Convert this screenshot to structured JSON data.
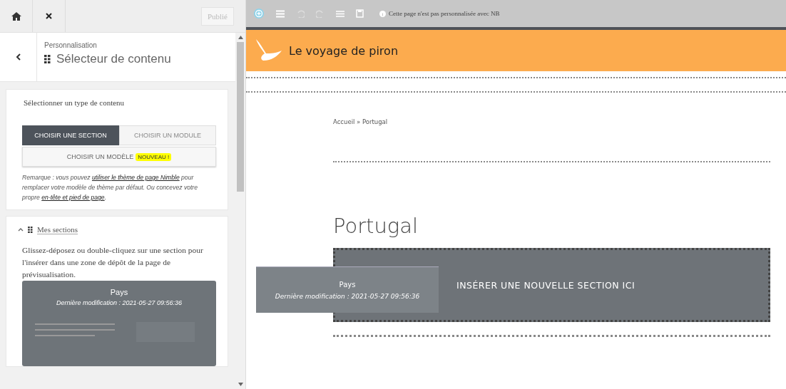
{
  "topbar": {
    "publish": "Publié"
  },
  "header": {
    "breadcrumb": "Personnalisation",
    "title": "Sélecteur de contenu"
  },
  "content_type": {
    "label": "Sélectionner un type de contenu",
    "tabs": [
      {
        "label": "CHOISIR UNE SECTION",
        "selected": true
      },
      {
        "label": "CHOISIR UN MODULE",
        "selected": false
      }
    ],
    "template_button": "CHOISIR UN MODÈLE",
    "template_badge": "NOUVEAU !",
    "note": [
      {
        "kind": "text",
        "text": "Remarque : vous pouvez "
      },
      {
        "kind": "link",
        "text": "utiliser le thème de page Nimble"
      },
      {
        "kind": "text",
        "text": " pour remplacer votre modèle de thème par défaut. Ou concevez votre propre "
      },
      {
        "kind": "link",
        "text": "en-tête et pied de page"
      },
      {
        "kind": "text",
        "text": "."
      }
    ]
  },
  "my_sections": {
    "title": "Mes sections",
    "expanded": true,
    "description": "Glissez-déposez ou double-cliquez sur une section pour l'insérer dans une zone de dépôt de la page de prévisualisation.",
    "cards": [
      {
        "name": "Pays",
        "modified": "Dernière modification : 2021-05-27 09:56:36"
      }
    ]
  },
  "preview": {
    "toolbar": {
      "notice": "Cette page n'est pas personnalisée avec NB"
    },
    "site_title": "Le voyage de piron",
    "breadcrumb": "Accueil » Portugal",
    "page_title": "Portugal",
    "drop_zone": "INSÉRER UNE NOUVELLE SECTION ICI",
    "drag_ghost": {
      "name": "Pays",
      "modified": "Dernière modification : 2021-05-27 09:56:36"
    }
  }
}
